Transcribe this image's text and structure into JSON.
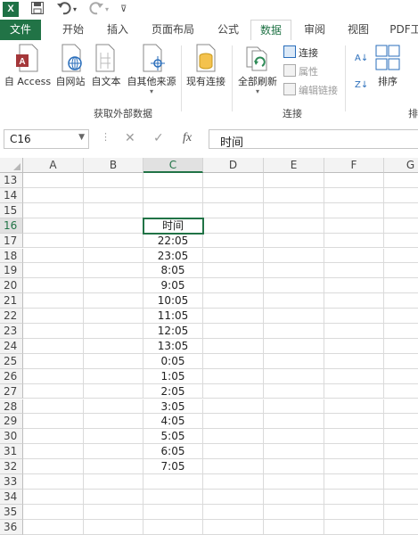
{
  "title_bar": {
    "logo_text": "X",
    "save_icon": "save-icon",
    "undo_icon": "undo-icon",
    "redo_icon": "redo-icon",
    "qat_more_icon": "customize-qat-icon"
  },
  "tabs": [
    {
      "label": "文件",
      "active": false
    },
    {
      "label": "开始",
      "active": false
    },
    {
      "label": "插入",
      "active": false
    },
    {
      "label": "页面布局",
      "active": false
    },
    {
      "label": "公式",
      "active": false
    },
    {
      "label": "数据",
      "active": true
    },
    {
      "label": "审阅",
      "active": false
    },
    {
      "label": "视图",
      "active": false
    },
    {
      "label": "PDF工",
      "active": false
    }
  ],
  "ribbon": {
    "get_external": {
      "label": "获取外部数据",
      "buttons": [
        "自 Access",
        "自网站",
        "自文本",
        "自其他来源"
      ]
    },
    "existing_connections": "现有连接",
    "connections": {
      "label": "连接",
      "refresh_all": "全部刷新",
      "connections_btn": "连接",
      "properties_btn": "属性",
      "edit_links_btn": "编辑链接"
    },
    "sort": {
      "sort_btn": "排序",
      "group_label_cut": "排"
    }
  },
  "formula_bar": {
    "name_box": "C16",
    "cancel_icon": "cancel-icon",
    "enter_icon": "enter-icon",
    "fx_icon": "fx-icon",
    "value": "时间"
  },
  "grid": {
    "columns": [
      "A",
      "B",
      "C",
      "D",
      "E",
      "F",
      "G"
    ],
    "selected_column": "C",
    "rows": [
      {
        "n": "13",
        "c": ""
      },
      {
        "n": "14",
        "c": ""
      },
      {
        "n": "15",
        "c": ""
      },
      {
        "n": "16",
        "c": "时间"
      },
      {
        "n": "17",
        "c": "22:05"
      },
      {
        "n": "18",
        "c": "23:05"
      },
      {
        "n": "19",
        "c": "8:05"
      },
      {
        "n": "20",
        "c": "9:05"
      },
      {
        "n": "21",
        "c": "10:05"
      },
      {
        "n": "22",
        "c": "11:05"
      },
      {
        "n": "23",
        "c": "12:05"
      },
      {
        "n": "24",
        "c": "13:05"
      },
      {
        "n": "25",
        "c": "0:05"
      },
      {
        "n": "26",
        "c": "1:05"
      },
      {
        "n": "27",
        "c": "2:05"
      },
      {
        "n": "28",
        "c": "3:05"
      },
      {
        "n": "29",
        "c": "4:05"
      },
      {
        "n": "30",
        "c": "5:05"
      },
      {
        "n": "31",
        "c": "6:05"
      },
      {
        "n": "32",
        "c": "7:05"
      },
      {
        "n": "33",
        "c": ""
      },
      {
        "n": "34",
        "c": ""
      },
      {
        "n": "35",
        "c": ""
      },
      {
        "n": "36",
        "c": ""
      }
    ],
    "selected_row": "16"
  },
  "colors": {
    "accent": "#217346",
    "header_bg": "#f3f3f3"
  }
}
